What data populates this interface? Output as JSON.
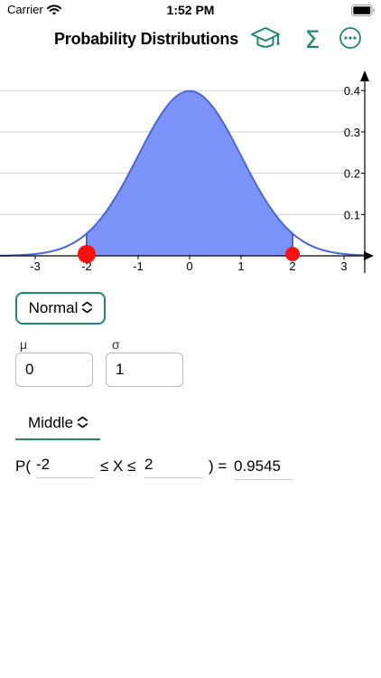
{
  "status": {
    "carrier": "Carrier",
    "time": "1:52 PM"
  },
  "nav": {
    "title": "Probability Distributions",
    "sum_symbol": "Σ"
  },
  "chart_data": {
    "type": "area",
    "distribution": "normal",
    "mu": 0,
    "sigma": 1,
    "x_ticks": [
      "-3",
      "-2",
      "-1",
      "0",
      "1",
      "2",
      "3"
    ],
    "y_ticks": [
      "0.1",
      "0.2",
      "0.3",
      "0.4"
    ],
    "xlim": [
      -3.7,
      3.5
    ],
    "ylim": [
      0,
      0.4
    ],
    "shaded_interval": [
      -2,
      2
    ],
    "markers": [
      -2,
      2
    ],
    "colors": {
      "fill": "#7b93fb",
      "curve": "#4b66d6",
      "marker": "#ff1010",
      "grid": "#cfcfcf"
    }
  },
  "distribution": {
    "selected": "Normal"
  },
  "params": {
    "mu_label": "μ",
    "sigma_label": "σ",
    "mu_value": "0",
    "sigma_value": "1"
  },
  "interval": {
    "selected": "Middle"
  },
  "equation": {
    "prefix": "P(",
    "lower": "-2",
    "middle": "≤ X ≤",
    "upper": "2",
    "suffix": ") =",
    "result": "0.9545"
  },
  "accent_color": "#1e8a6a"
}
